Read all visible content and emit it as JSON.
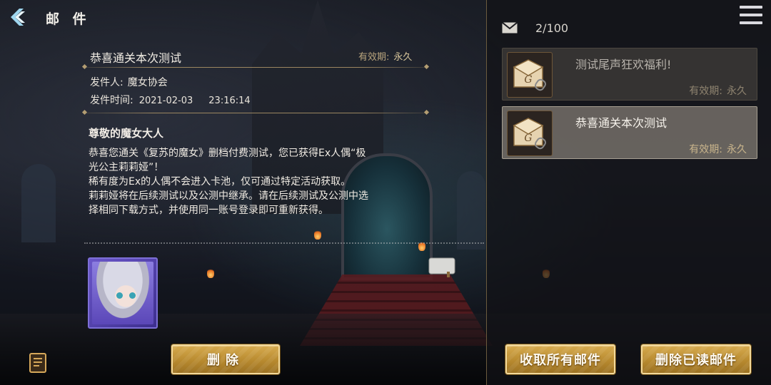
{
  "header": {
    "title": "邮 件",
    "back_icon": "chevron-left-icon",
    "menu_icon": "hamburger-menu-icon"
  },
  "mailbox": {
    "count": "2/100",
    "count_icon": "envelope-icon"
  },
  "detail": {
    "title": "恭喜通关本次测试",
    "validity_label": "有效期:",
    "validity_value": "永久",
    "sender_label": "发件人:",
    "sender_value": "魔女协会",
    "time_label": "发件时间:",
    "time_date": "2021-02-03",
    "time_clock": "23:16:14",
    "greeting": "尊敬的魔女大人",
    "body_lines": [
      "恭喜您通关《复苏的魔女》删档付费测试，您已获得Ex人偶“极",
      "光公主莉莉娅”！",
      "稀有度为Ex的人偶不会进入卡池，仅可通过特定活动获取。",
      "莉莉娅将在后续测试以及公测中继承。请在后续测试及公测中选",
      "择相同下载方式，并使用同一账号登录即可重新获得。"
    ],
    "attachment_icon": "character-portrait-icon"
  },
  "mail_list": [
    {
      "title": "测试尾声狂欢福利!",
      "validity_label": "有效期:",
      "validity_value": "永久",
      "icon": "letter-with-attachment-icon",
      "selected": false
    },
    {
      "title": "恭喜通关本次测试",
      "validity_label": "有效期:",
      "validity_value": "永久",
      "icon": "letter-with-attachment-icon",
      "selected": true
    }
  ],
  "buttons": {
    "delete": "删除",
    "claim_all": "收取所有邮件",
    "delete_read": "删除已读邮件"
  },
  "colors": {
    "gold_button": "#c99a3c",
    "gold_border": "#f3d99a",
    "panel_border": "#6b5b3e",
    "validity_text": "#c9b58c",
    "attachment_frame": "#7d6fd6"
  }
}
